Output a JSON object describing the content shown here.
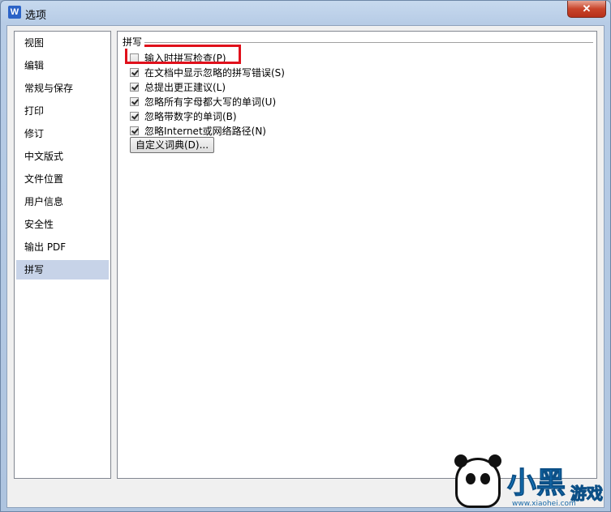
{
  "window": {
    "title": "选项",
    "app_icon": "W",
    "close_glyph": "✕"
  },
  "sidebar": {
    "items": [
      {
        "label": "视图"
      },
      {
        "label": "编辑"
      },
      {
        "label": "常规与保存"
      },
      {
        "label": "打印"
      },
      {
        "label": "修订"
      },
      {
        "label": "中文版式"
      },
      {
        "label": "文件位置"
      },
      {
        "label": "用户信息"
      },
      {
        "label": "安全性"
      },
      {
        "label": "输出 PDF"
      },
      {
        "label": "拼写",
        "selected": true
      }
    ]
  },
  "spelling": {
    "group_title": "拼写",
    "options": [
      {
        "label": "输入时拼写检查(P)",
        "checked": false
      },
      {
        "label": "在文档中显示忽略的拼写错误(S)",
        "checked": true
      },
      {
        "label": "总提出更正建议(L)",
        "checked": true
      },
      {
        "label": "忽略所有字母都大写的单词(U)",
        "checked": true
      },
      {
        "label": "忽略带数字的单词(B)",
        "checked": true
      },
      {
        "label": "忽略Internet或网络路径(N)",
        "checked": true
      }
    ],
    "custom_dict_button": "自定义词典(D)..."
  },
  "watermark": {
    "text_main": "小黑",
    "text_sub": "游戏",
    "url": "www.xiaohei.com"
  },
  "colors": {
    "highlight": "#e0101b",
    "selected_nav": "#c7d3e8",
    "close_button": "#c8442a"
  }
}
